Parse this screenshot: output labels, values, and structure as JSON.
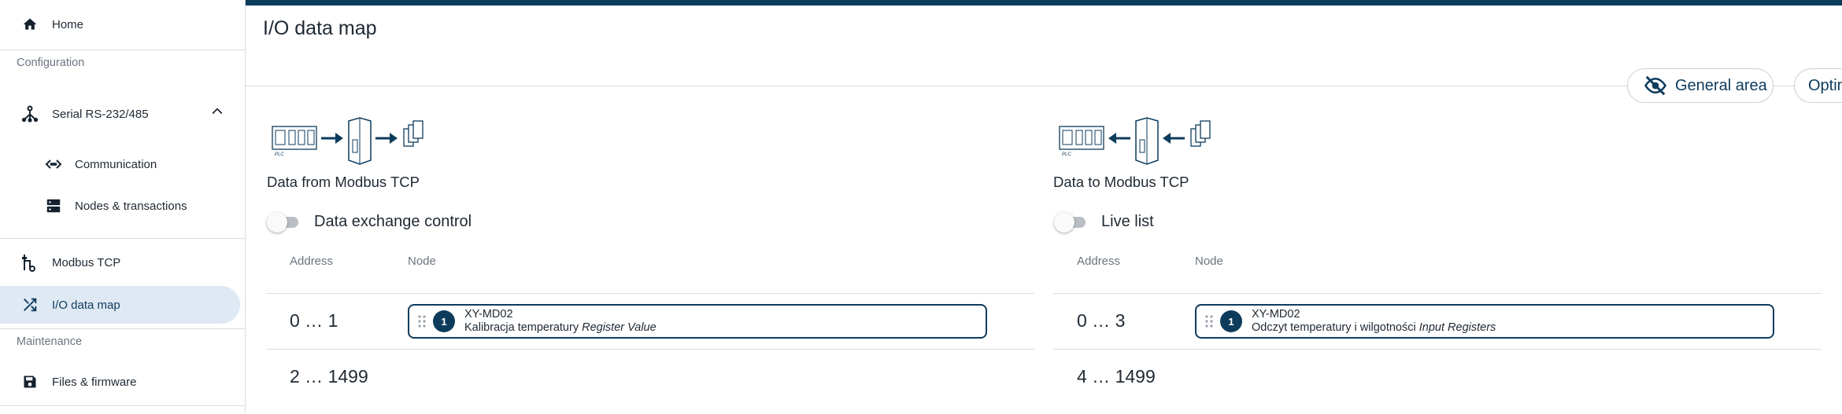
{
  "sidebar": {
    "home": "Home",
    "section_configuration": "Configuration",
    "serial": "Serial RS-232/485",
    "communication": "Communication",
    "nodes": "Nodes & transactions",
    "modbus_tcp": "Modbus TCP",
    "io_data_map": "I/O data map",
    "section_maintenance": "Maintenance",
    "files": "Files & firmware"
  },
  "page": {
    "title": "I/O data map"
  },
  "toolbar": {
    "general_area": "General area",
    "optim": "Optim"
  },
  "left_panel": {
    "plc_label": "PLC",
    "caption": "Data from Modbus TCP",
    "toggle_label": "Data exchange control",
    "col_address": "Address",
    "col_node": "Node",
    "rows": [
      {
        "address": "0 … 1",
        "node_number": "1",
        "node_name": "XY-MD02",
        "transaction": "Kalibracja temperatury",
        "type": "Register Value"
      },
      {
        "address": "2 … 1499"
      }
    ]
  },
  "right_panel": {
    "plc_label": "PLC",
    "caption": "Data to Modbus TCP",
    "toggle_label": "Live list",
    "col_address": "Address",
    "col_node": "Node",
    "rows": [
      {
        "address": "0 … 3",
        "node_number": "1",
        "node_name": "XY-MD02",
        "transaction": "Odczyt temperatury i wilgotności",
        "type": "Input Registers"
      },
      {
        "address": "4 … 1499"
      }
    ]
  },
  "colors": {
    "brand": "#0d3b5c",
    "active_nav_bg": "#dfe9f4"
  }
}
